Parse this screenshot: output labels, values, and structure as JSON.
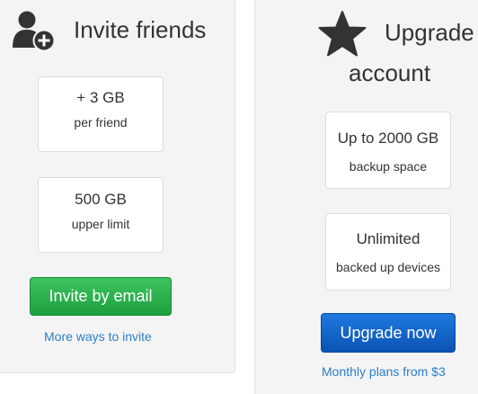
{
  "invite": {
    "icon": "add-user-icon",
    "title": "Invite friends",
    "cards": [
      {
        "value": "+ 3 GB",
        "sub": "per friend"
      },
      {
        "value": "500 GB",
        "sub": "upper limit"
      }
    ],
    "button_label": "Invite by email",
    "link_label": "More ways to invite"
  },
  "upgrade": {
    "icon": "star-icon",
    "title_line1": "Upgrade",
    "title_line2": "account",
    "cards": [
      {
        "value": "Up to 2000 GB",
        "sub": "backup space"
      },
      {
        "value": "Unlimited",
        "sub": "backed up devices"
      }
    ],
    "button_label": "Upgrade now",
    "link_label": "Monthly plans from $3"
  },
  "colors": {
    "panel_bg": "#f4f4f4",
    "invite_button": "#27b04a",
    "upgrade_button": "#0d5fc4",
    "link": "#2a7ec8",
    "icon": "#333333"
  }
}
